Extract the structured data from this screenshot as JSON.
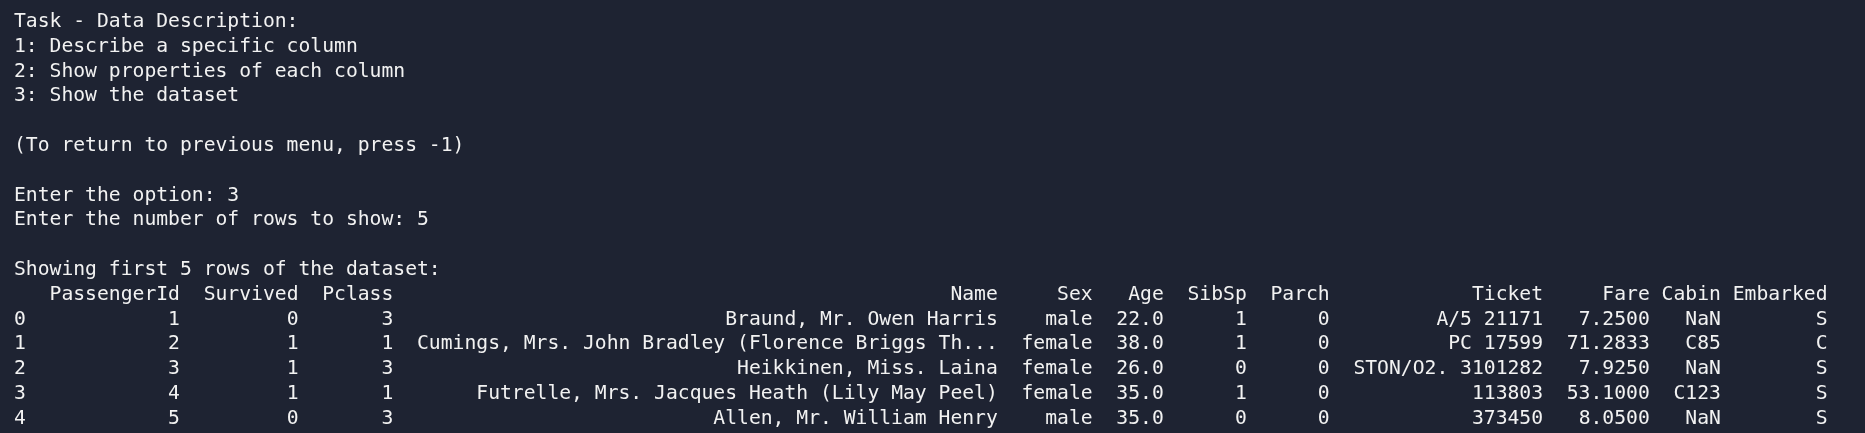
{
  "blocks": [
    {
      "lines": [
        "Task - Data Description:",
        "1: Describe a specific column",
        "2: Show properties of each column",
        "3: Show the dataset"
      ]
    },
    {
      "lines": [
        "(To return to previous menu, press -1)"
      ]
    },
    {
      "lines": [
        "Enter the option: 3",
        "Enter the number of rows to show: 5"
      ]
    }
  ],
  "table": {
    "caption": "Showing first 5 rows of the dataset:",
    "columns": [
      "PassengerId",
      "Survived",
      "Pclass",
      "Name",
      "Sex",
      "Age",
      "SibSp",
      "Parch",
      "Ticket",
      "Fare",
      "Cabin",
      "Embarked"
    ],
    "rows": [
      {
        "index": "0",
        "cells": [
          "1",
          "0",
          "3",
          "Braund, Mr. Owen Harris",
          "male",
          "22.0",
          "1",
          "0",
          "A/5 21171",
          "7.2500",
          "NaN",
          "S"
        ]
      },
      {
        "index": "1",
        "cells": [
          "2",
          "1",
          "1",
          "Cumings, Mrs. John Bradley (Florence Briggs Th...",
          "female",
          "38.0",
          "1",
          "0",
          "PC 17599",
          "71.2833",
          "C85",
          "C"
        ]
      },
      {
        "index": "2",
        "cells": [
          "3",
          "1",
          "3",
          "Heikkinen, Miss. Laina",
          "female",
          "26.0",
          "0",
          "0",
          "STON/O2. 3101282",
          "7.9250",
          "NaN",
          "S"
        ]
      },
      {
        "index": "3",
        "cells": [
          "4",
          "1",
          "1",
          "Futrelle, Mrs. Jacques Heath (Lily May Peel)",
          "female",
          "35.0",
          "1",
          "0",
          "113803",
          "53.1000",
          "C123",
          "S"
        ]
      },
      {
        "index": "4",
        "cells": [
          "5",
          "0",
          "3",
          "Allen, Mr. William Henry",
          "male",
          "35.0",
          "0",
          "0",
          "373450",
          "8.0500",
          "NaN",
          "S"
        ]
      }
    ]
  }
}
